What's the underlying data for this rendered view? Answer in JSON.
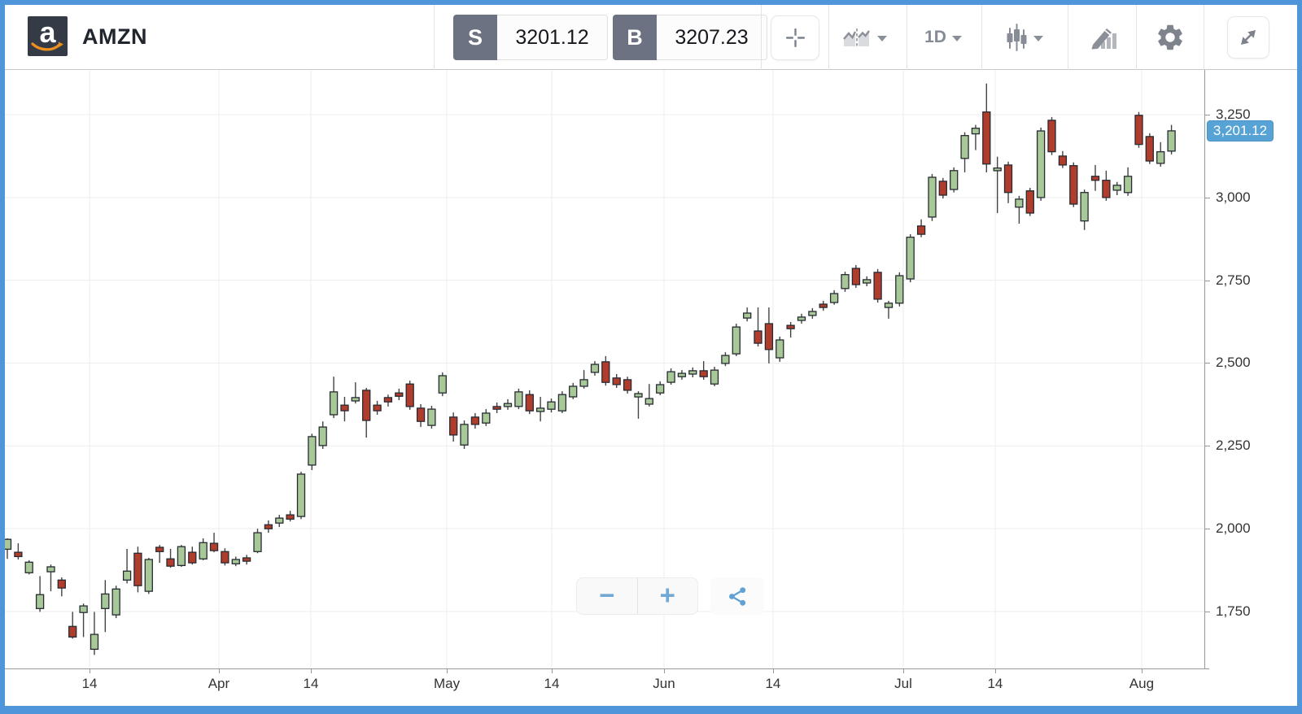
{
  "header": {
    "symbol": "AMZN",
    "sell": {
      "label": "S",
      "price": "3201.12"
    },
    "buy": {
      "label": "B",
      "price": "3207.23"
    },
    "timeframe": "1D"
  },
  "controls": {
    "zoom_out": "−",
    "zoom_in": "+"
  },
  "colors": {
    "frame_blue": "#4e96d9",
    "accent_blue": "#57a3d6",
    "icon_gray": "#7e838d",
    "candle_up": "#a9c898",
    "candle_down": "#b03d2c"
  },
  "chart_data": {
    "type": "candlestick",
    "symbol": "AMZN",
    "interval": "1D",
    "title": "AMZN daily candlestick chart, mid-March to early August",
    "last_price": 3201.12,
    "last_price_label": "3,201.12",
    "up_color": "#a9c898",
    "down_color": "#b03d2c",
    "outline_color": "#262b33",
    "wick_color": "#434345",
    "grid_color": "#ededee",
    "ylim": [
      1600,
      3400
    ],
    "y_axis": {
      "ticks": [
        {
          "price": 3250,
          "label": "3,250"
        },
        {
          "price": 3000,
          "label": "3,000"
        },
        {
          "price": 2750,
          "label": "2,750"
        },
        {
          "price": 2500,
          "label": "2,500"
        },
        {
          "price": 2250,
          "label": "2,250"
        },
        {
          "price": 2000,
          "label": "2,000"
        },
        {
          "price": 1750,
          "label": "1,750"
        }
      ]
    },
    "x_axis": {
      "ticks": [
        {
          "label": "14",
          "frac": 0.0706
        },
        {
          "label": "Apr",
          "frac": 0.1784
        },
        {
          "label": "14",
          "frac": 0.2551
        },
        {
          "label": "May",
          "frac": 0.3684
        },
        {
          "label": "14",
          "frac": 0.4559
        },
        {
          "label": "Jun",
          "frac": 0.5495
        },
        {
          "label": "14",
          "frac": 0.6404
        },
        {
          "label": "Jul",
          "frac": 0.749
        },
        {
          "label": "14",
          "frac": 0.8256
        },
        {
          "label": "Aug",
          "frac": 0.9477
        }
      ]
    },
    "candles_format": [
      "open",
      "high",
      "low",
      "close"
    ],
    "candles": [
      [
        1938,
        1971,
        1909,
        1968
      ],
      [
        1929,
        1956,
        1907,
        1916
      ],
      [
        1867,
        1905,
        1862,
        1899
      ],
      [
        1759,
        1857,
        1749,
        1801
      ],
      [
        1870,
        1892,
        1811,
        1885
      ],
      [
        1845,
        1853,
        1796,
        1821
      ],
      [
        1705,
        1749,
        1668,
        1673
      ],
      [
        1747,
        1774,
        1673,
        1767
      ],
      [
        1636,
        1749,
        1619,
        1681
      ],
      [
        1759,
        1845,
        1688,
        1803
      ],
      [
        1740,
        1828,
        1730,
        1818
      ],
      [
        1845,
        1939,
        1835,
        1872
      ],
      [
        1926,
        1946,
        1808,
        1828
      ],
      [
        1811,
        1912,
        1803,
        1907
      ],
      [
        1944,
        1951,
        1897,
        1931
      ],
      [
        1909,
        1939,
        1882,
        1887
      ],
      [
        1889,
        1951,
        1885,
        1946
      ],
      [
        1929,
        1946,
        1892,
        1897
      ],
      [
        1909,
        1971,
        1905,
        1958
      ],
      [
        1956,
        1988,
        1929,
        1934
      ],
      [
        1931,
        1941,
        1889,
        1897
      ],
      [
        1894,
        1916,
        1887,
        1907
      ],
      [
        1912,
        1921,
        1892,
        1902
      ],
      [
        1931,
        2000,
        1926,
        1988
      ],
      [
        2012,
        2025,
        1988,
        2000
      ],
      [
        2017,
        2042,
        2005,
        2032
      ],
      [
        2042,
        2054,
        2022,
        2029
      ],
      [
        2037,
        2172,
        2029,
        2165
      ],
      [
        2192,
        2287,
        2177,
        2278
      ],
      [
        2251,
        2324,
        2241,
        2307
      ],
      [
        2344,
        2459,
        2334,
        2413
      ],
      [
        2373,
        2398,
        2324,
        2356
      ],
      [
        2386,
        2442,
        2378,
        2396
      ],
      [
        2418,
        2425,
        2275,
        2327
      ],
      [
        2373,
        2386,
        2344,
        2356
      ],
      [
        2396,
        2405,
        2369,
        2383
      ],
      [
        2410,
        2423,
        2388,
        2400
      ],
      [
        2437,
        2447,
        2359,
        2369
      ],
      [
        2364,
        2376,
        2307,
        2324
      ],
      [
        2312,
        2371,
        2302,
        2361
      ],
      [
        2410,
        2472,
        2400,
        2462
      ],
      [
        2337,
        2351,
        2263,
        2283
      ],
      [
        2253,
        2327,
        2241,
        2315
      ],
      [
        2337,
        2349,
        2302,
        2315
      ],
      [
        2319,
        2361,
        2310,
        2349
      ],
      [
        2369,
        2381,
        2349,
        2361
      ],
      [
        2369,
        2391,
        2359,
        2378
      ],
      [
        2369,
        2423,
        2361,
        2413
      ],
      [
        2405,
        2418,
        2346,
        2356
      ],
      [
        2354,
        2398,
        2324,
        2364
      ],
      [
        2361,
        2393,
        2351,
        2383
      ],
      [
        2356,
        2415,
        2349,
        2405
      ],
      [
        2398,
        2440,
        2391,
        2430
      ],
      [
        2430,
        2479,
        2423,
        2450
      ],
      [
        2472,
        2506,
        2462,
        2496
      ],
      [
        2504,
        2521,
        2432,
        2442
      ],
      [
        2455,
        2467,
        2425,
        2435
      ],
      [
        2450,
        2459,
        2408,
        2418
      ],
      [
        2398,
        2415,
        2332,
        2408
      ],
      [
        2376,
        2437,
        2369,
        2393
      ],
      [
        2410,
        2445,
        2403,
        2435
      ],
      [
        2442,
        2484,
        2435,
        2474
      ],
      [
        2459,
        2479,
        2450,
        2469
      ],
      [
        2467,
        2487,
        2457,
        2477
      ],
      [
        2477,
        2506,
        2450,
        2459
      ],
      [
        2437,
        2489,
        2430,
        2479
      ],
      [
        2499,
        2533,
        2491,
        2523
      ],
      [
        2528,
        2619,
        2521,
        2609
      ],
      [
        2636,
        2668,
        2626,
        2651
      ],
      [
        2597,
        2668,
        2550,
        2560
      ],
      [
        2619,
        2668,
        2499,
        2541
      ],
      [
        2516,
        2580,
        2504,
        2570
      ],
      [
        2614,
        2624,
        2577,
        2604
      ],
      [
        2629,
        2649,
        2619,
        2639
      ],
      [
        2644,
        2666,
        2634,
        2656
      ],
      [
        2678,
        2688,
        2658,
        2668
      ],
      [
        2683,
        2720,
        2676,
        2710
      ],
      [
        2725,
        2776,
        2715,
        2767
      ],
      [
        2786,
        2796,
        2727,
        2737
      ],
      [
        2742,
        2762,
        2732,
        2752
      ],
      [
        2774,
        2784,
        2683,
        2693
      ],
      [
        2668,
        2688,
        2634,
        2681
      ],
      [
        2681,
        2774,
        2671,
        2764
      ],
      [
        2754,
        2889,
        2744,
        2880
      ],
      [
        2914,
        2934,
        2880,
        2889
      ],
      [
        2941,
        3071,
        2929,
        3061
      ],
      [
        3049,
        3059,
        2997,
        3007
      ],
      [
        3024,
        3091,
        3015,
        3081
      ],
      [
        3118,
        3197,
        3076,
        3187
      ],
      [
        3192,
        3219,
        3143,
        3209
      ],
      [
        3258,
        3344,
        3076,
        3101
      ],
      [
        3081,
        3123,
        2953,
        3089
      ],
      [
        3098,
        3108,
        2983,
        3015
      ],
      [
        2971,
        3005,
        2921,
        2995
      ],
      [
        3020,
        3029,
        2944,
        2953
      ],
      [
        3000,
        3211,
        2990,
        3201
      ],
      [
        3233,
        3243,
        3128,
        3138
      ],
      [
        3125,
        3140,
        3089,
        3098
      ],
      [
        3096,
        3106,
        2971,
        2980
      ],
      [
        2929,
        3024,
        2902,
        3015
      ],
      [
        3064,
        3098,
        3020,
        3052
      ],
      [
        3052,
        3081,
        2990,
        3000
      ],
      [
        3022,
        3047,
        3007,
        3037
      ],
      [
        3015,
        3091,
        3005,
        3064
      ],
      [
        3248,
        3258,
        3150,
        3160
      ],
      [
        3184,
        3194,
        3101,
        3110
      ],
      [
        3103,
        3167,
        3093,
        3138
      ],
      [
        3140,
        3219,
        3130,
        3201.12
      ]
    ]
  }
}
